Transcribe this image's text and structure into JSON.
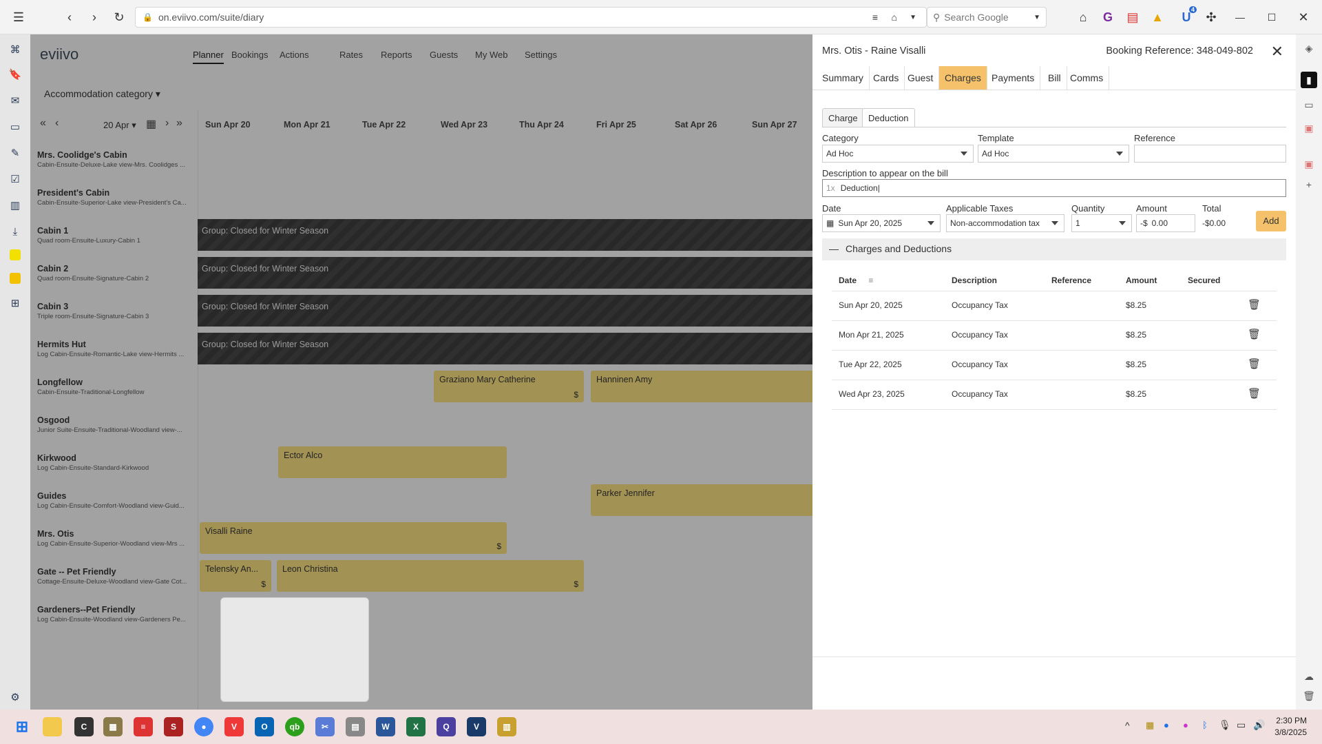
{
  "browser": {
    "url": "on.eviivo.com/suite/diary",
    "search_placeholder": "Search Google",
    "ext_badge": "4"
  },
  "app": {
    "logo": "eviivo",
    "nav": [
      "Planner",
      "Bookings",
      "Actions",
      "Rates",
      "Reports",
      "Guests",
      "My Web",
      "Settings"
    ],
    "accommodation_select": "Accommodation category",
    "date_select": "20 Apr",
    "days": [
      "Sun Apr 20",
      "Mon Apr 21",
      "Tue Apr 22",
      "Wed Apr 23",
      "Thu Apr 24",
      "Fri Apr 25",
      "Sat Apr 26",
      "Sun Apr 27"
    ],
    "rooms": [
      {
        "name": "Mrs. Coolidge's Cabin",
        "sub": "Cabin-Ensuite-Deluxe-Lake view-Mrs. Coolidges ..."
      },
      {
        "name": "President's Cabin",
        "sub": "Cabin-Ensuite-Superior-Lake view-President's Ca..."
      },
      {
        "name": "Cabin 1",
        "sub": "Quad room-Ensuite-Luxury-Cabin 1"
      },
      {
        "name": "Cabin 2",
        "sub": "Quad room-Ensuite-Signature-Cabin 2"
      },
      {
        "name": "Cabin 3",
        "sub": "Triple room-Ensuite-Signature-Cabin 3"
      },
      {
        "name": "Hermits Hut",
        "sub": "Log Cabin-Ensuite-Romantic-Lake view-Hermits ..."
      },
      {
        "name": "Longfellow",
        "sub": "Cabin-Ensuite-Traditional-Longfellow"
      },
      {
        "name": "Osgood",
        "sub": "Junior Suite-Ensuite-Traditional-Woodland view-..."
      },
      {
        "name": "Kirkwood",
        "sub": "Log Cabin-Ensuite-Standard-Kirkwood"
      },
      {
        "name": "Guides",
        "sub": "Log Cabin-Ensuite-Comfort-Woodland view-Guid..."
      },
      {
        "name": "Mrs. Otis",
        "sub": "Log Cabin-Ensuite-Superior-Woodland view-Mrs ..."
      },
      {
        "name": "Gate -- Pet Friendly",
        "sub": "Cottage-Ensuite-Deluxe-Woodland view-Gate Cot..."
      },
      {
        "name": "Gardeners--Pet Friendly",
        "sub": "Log Cabin-Ensuite-Woodland view-Gardeners Pe..."
      }
    ],
    "closed_label": "Group: Closed for Winter Season",
    "bookings": {
      "graziano": "Graziano Mary Catherine",
      "hanninen": "Hanninen Amy",
      "ector": "Ector Alco",
      "parker": "Parker Jennifer",
      "visalli": "Visalli Raine",
      "telensky": "Telensky An...",
      "leon": "Leon Christina",
      "dollar": "$"
    }
  },
  "panel": {
    "title": "Mrs. Otis - Raine Visalli",
    "booking_ref": "Booking Reference: 348-049-802",
    "tabs": [
      "Summary",
      "Cards",
      "Guest",
      "Charges",
      "Payments",
      "Bill",
      "Comms"
    ],
    "subtabs": [
      "Charge",
      "Deduction"
    ],
    "form": {
      "category_label": "Category",
      "category_value": "Ad Hoc",
      "template_label": "Template",
      "template_value": "Ad Hoc",
      "reference_label": "Reference",
      "reference_value": "",
      "description_label": "Description to appear on the bill",
      "description_prefix": "1x",
      "description_value": "Deduction",
      "date_label": "Date",
      "date_value": "Sun Apr 20, 2025",
      "taxes_label": "Applicable Taxes",
      "taxes_value": "Non-accommodation tax",
      "quantity_label": "Quantity",
      "quantity_value": "1",
      "amount_label": "Amount",
      "amount_prefix": "-$",
      "amount_value": "0.00",
      "total_label": "Total",
      "total_value": "-$0.00",
      "add_label": "Add"
    },
    "section_title": "Charges and Deductions",
    "columns": [
      "Date",
      "Description",
      "Reference",
      "Amount",
      "Secured"
    ],
    "rows": [
      {
        "date": "Sun Apr 20, 2025",
        "description": "Occupancy Tax",
        "reference": "",
        "amount": "$8.25"
      },
      {
        "date": "Mon Apr 21, 2025",
        "description": "Occupancy Tax",
        "reference": "",
        "amount": "$8.25"
      },
      {
        "date": "Tue Apr 22, 2025",
        "description": "Occupancy Tax",
        "reference": "",
        "amount": "$8.25"
      },
      {
        "date": "Wed Apr 23, 2025",
        "description": "Occupancy Tax",
        "reference": "",
        "amount": "$8.25"
      }
    ]
  },
  "taskbar": {
    "time": "2:30 PM",
    "date": "3/8/2025"
  },
  "colors": {
    "accent": "#f5c26b",
    "booking": "#e9d179",
    "closed": "#3a3a3a"
  }
}
